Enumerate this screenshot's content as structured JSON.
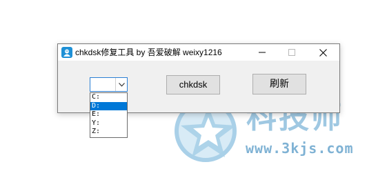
{
  "window": {
    "title": "chkdsk修复工具 by 吾爱破解 weixy1216",
    "minimize_glyph": "—",
    "maximize_glyph": "☐",
    "close_glyph": "✕"
  },
  "drive_combo": {
    "selected_value": "",
    "options": [
      "C:",
      "D:",
      "E:",
      "Y:",
      "Z:"
    ],
    "highlighted": "D:"
  },
  "buttons": {
    "chkdsk_label": "chkdsk",
    "refresh_label": "刷新"
  },
  "watermark": {
    "brand": "科技师",
    "url": "www.3kjs.com"
  },
  "icons": [
    "app-icon",
    "minimize-icon",
    "maximize-icon",
    "close-icon",
    "dropdown-arrow-icon"
  ],
  "colors": {
    "accent": "#0078d7",
    "watermark_blue": "#9fc8e2",
    "button_face": "#e1e1e1",
    "window_bg": "#f0f0f0"
  }
}
